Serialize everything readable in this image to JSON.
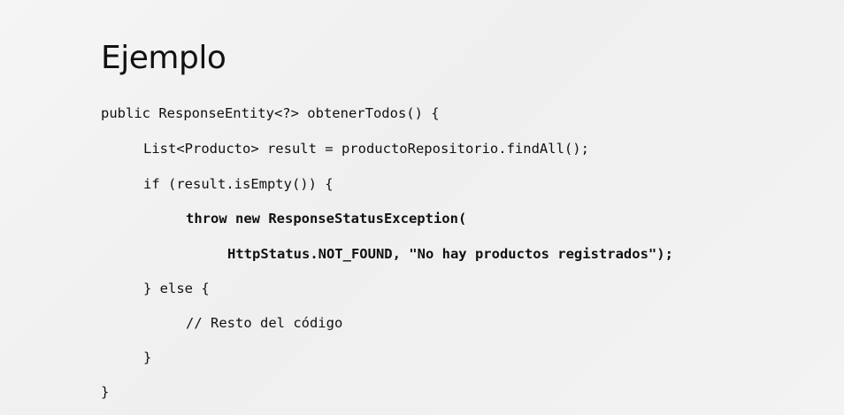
{
  "slide": {
    "title": "Ejemplo",
    "code_lines": [
      "public ResponseEntity<?> obtenerTodos() {",
      "List<Producto> result = productoRepositorio.findAll();",
      "if (result.isEmpty()) {",
      "throw new ResponseStatusException(",
      "HttpStatus.NOT_FOUND, \"No hay productos registrados\");",
      "} else {",
      "// Resto del código",
      "}",
      "}"
    ]
  }
}
